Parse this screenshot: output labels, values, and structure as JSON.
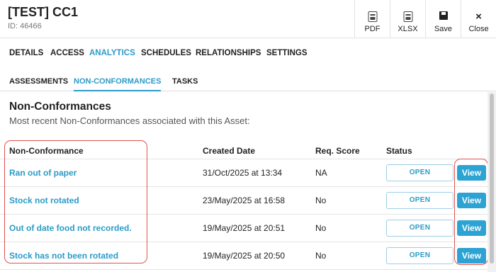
{
  "header": {
    "title": "[TEST] CC1",
    "id_label": "ID: 46466",
    "toolbar": {
      "pdf_label": "PDF",
      "xlsx_label": "XLSX",
      "save_label": "Save",
      "close_label": "Close"
    }
  },
  "main_tabs": [
    "DETAILS",
    "ACCESS",
    "ANALYTICS",
    "SCHEDULES",
    "RELATIONSHIPS",
    "SETTINGS"
  ],
  "main_tab_active": "ANALYTICS",
  "sub_tabs": [
    "ASSESSMENTS",
    "NON-CONFORMANCES",
    "TASKS"
  ],
  "sub_tab_active": "NON-CONFORMANCES",
  "section": {
    "title": "Non-Conformances",
    "subtitle": "Most recent Non-Conformances associated with this Asset:"
  },
  "table": {
    "columns": [
      "Non-Conformance",
      "Created Date",
      "Req. Score",
      "Status"
    ],
    "rows": [
      {
        "name": "Ran out of paper",
        "created": "31/Oct/2025 at 13:34",
        "score": "NA",
        "status": "OPEN",
        "action": "View"
      },
      {
        "name": "Stock not rotated",
        "created": "23/May/2025 at 16:58",
        "score": "No",
        "status": "OPEN",
        "action": "View"
      },
      {
        "name": "Out of date food not recorded.",
        "created": "19/May/2025 at 20:51",
        "score": "No",
        "status": "OPEN",
        "action": "View"
      },
      {
        "name": "Stock has not been rotated",
        "created": "19/May/2025 at 20:50",
        "score": "No",
        "status": "OPEN",
        "action": "View"
      }
    ]
  },
  "icons": {
    "pdf": "file-pdf-icon",
    "xlsx": "file-xlsx-icon",
    "save": "floppy-disk-icon",
    "close": "close-x-icon"
  },
  "colors": {
    "accent": "#2b9bc8",
    "view_button": "#2da3d3",
    "highlight": "#e0524e"
  }
}
